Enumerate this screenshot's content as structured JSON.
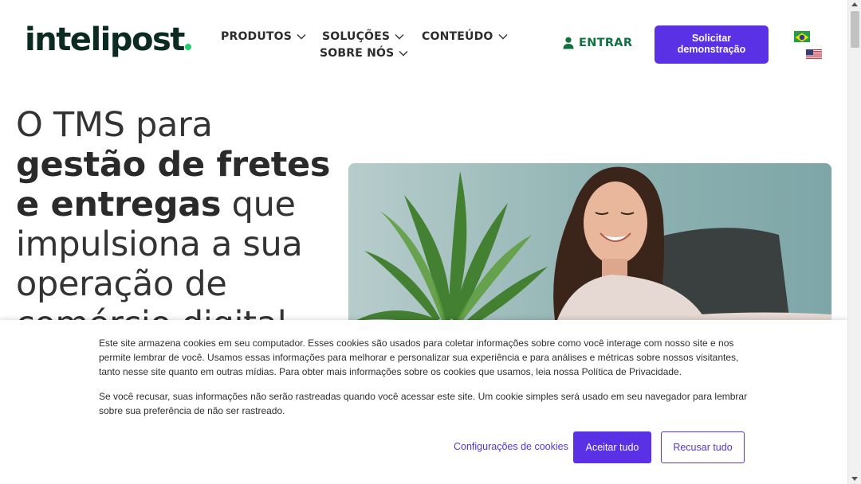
{
  "header": {
    "logo_text": "intelipost",
    "nav": {
      "produtos": "PRODUTOS",
      "solucoes": "SOLUÇÕES",
      "conteudo": "CONTEÚDO",
      "sobre": "SOBRE NÓS"
    },
    "login_label": "ENTRAR",
    "cta_label": "Solicitar demonstração",
    "languages": [
      "pt-BR",
      "en-US"
    ]
  },
  "hero": {
    "line1": "O TMS para",
    "bold1": "gestão de fretes",
    "bold2": "e entregas",
    "after_bold": " que",
    "line4": "impulsiona a sua",
    "line5": "operação de",
    "line6": "comércio digital"
  },
  "cookie": {
    "paragraph1": "Este site armazena cookies em seu computador. Esses cookies são usados para coletar informações sobre como você interage com nosso site e nos permite lembrar de você. Usamos essas informações para melhorar e personalizar sua experiência e para análises e métricas sobre nossos visitantes, tanto nesse site quanto em outras mídias. Para obter mais informações sobre os cookies que usamos, leia nossa Política de Privacidade.",
    "paragraph2": "Se você recusar, suas informações não serão rastreadas quando você acessar este site. Um cookie simples será usado em seu navegador para lembrar sobre sua preferência de não ser rastreado.",
    "settings_label": "Configurações de cookies",
    "accept_label": "Aceitar tudo",
    "reject_label": "Recusar tudo"
  },
  "colors": {
    "brand_purple": "#5b31e6",
    "brand_green": "#1fcf6c",
    "login_green": "#0f7040",
    "logo_dark": "#0b2b22"
  }
}
